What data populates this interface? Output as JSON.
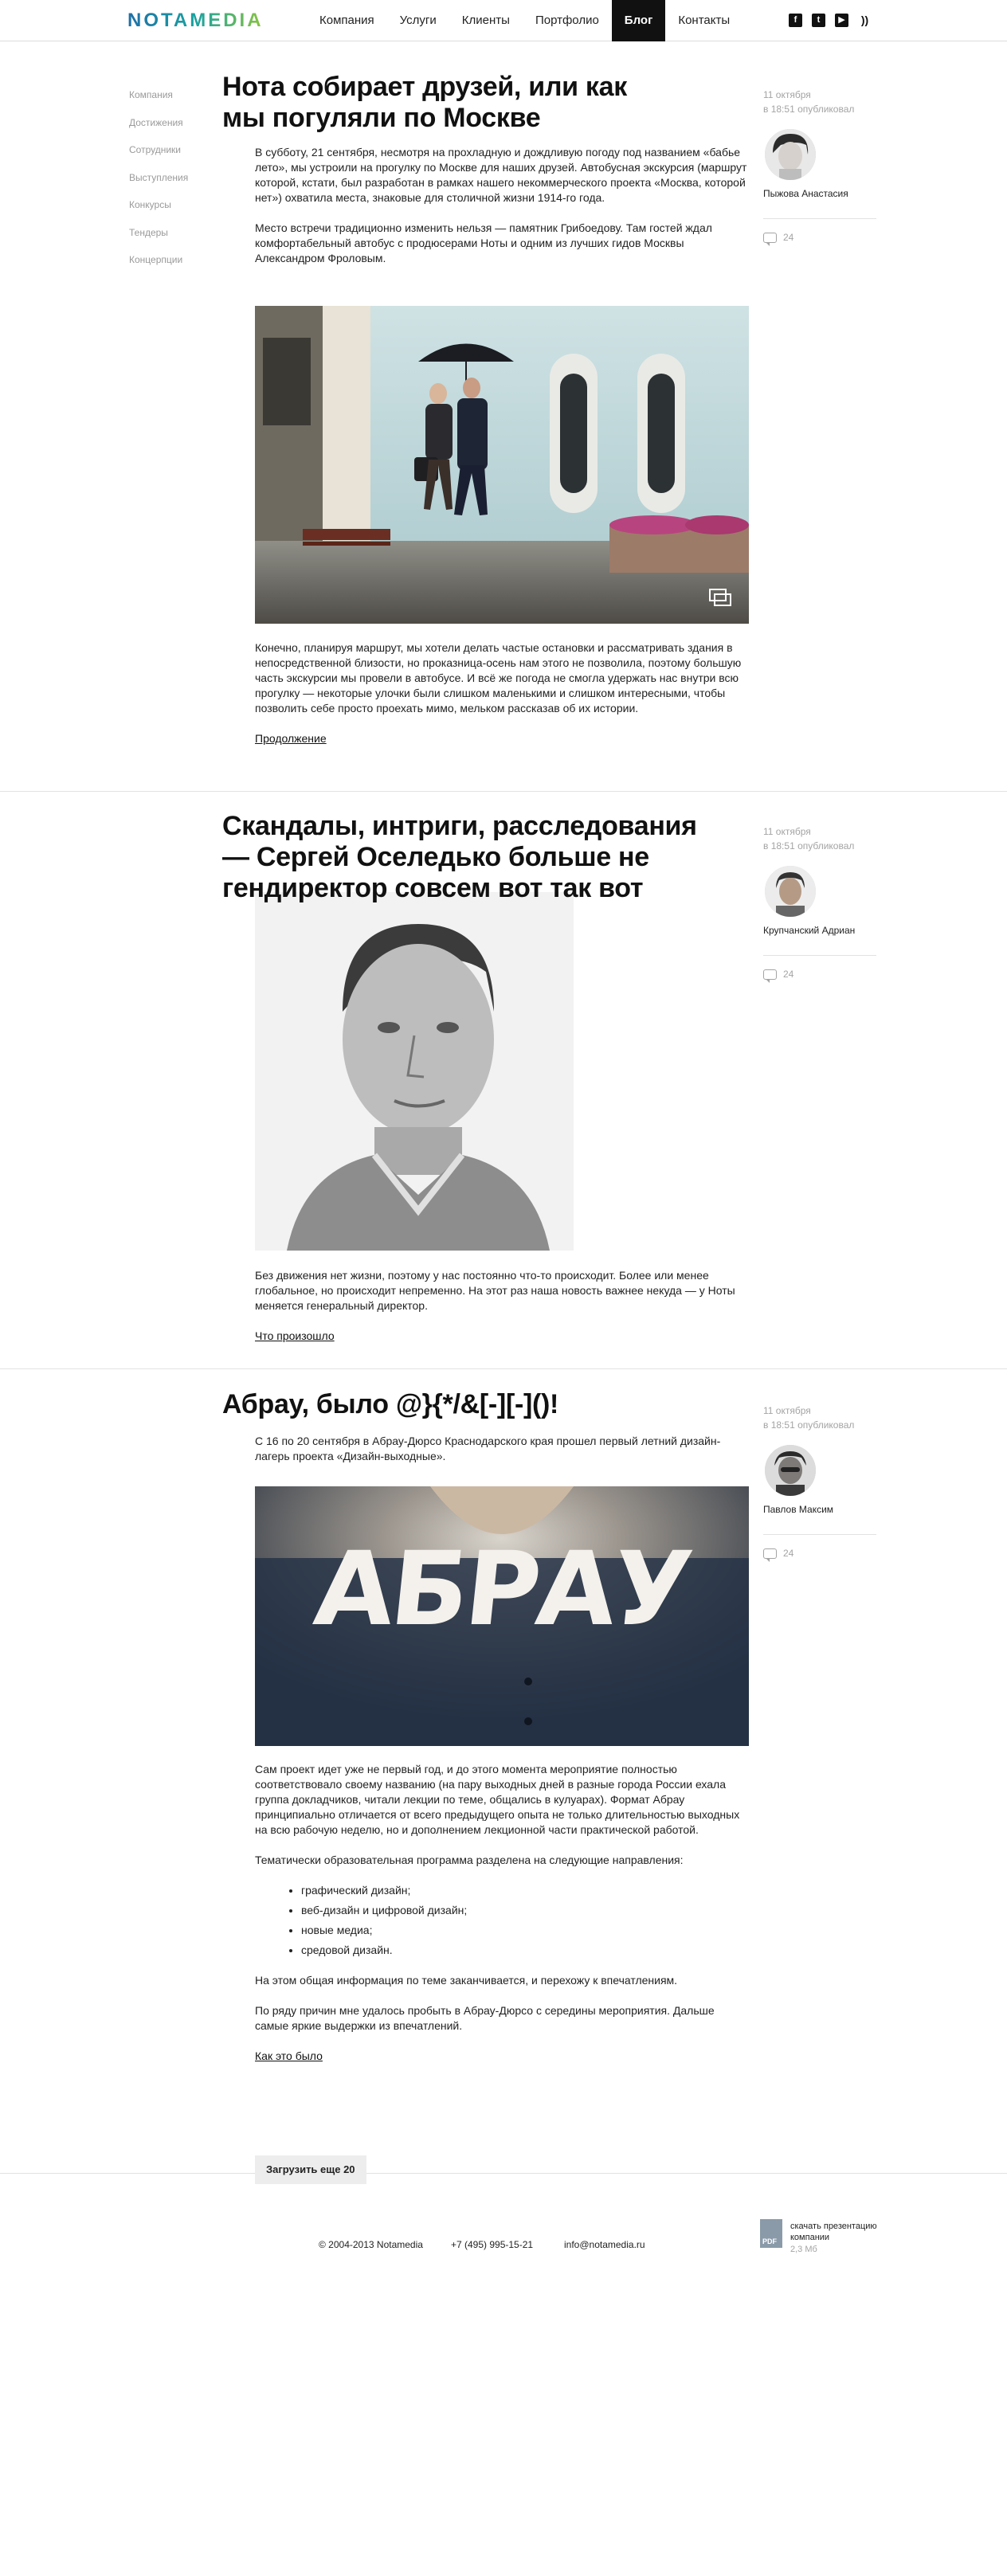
{
  "header": {
    "logo": "NOTAMEDIA",
    "nav": [
      "Компания",
      "Услуги",
      "Клиенты",
      "Портфолио",
      "Блог",
      "Контакты"
    ],
    "active_nav": "Блог",
    "social": [
      "f",
      "t",
      "▶",
      "rss"
    ]
  },
  "side_nav": [
    "Компания",
    "Достижения",
    "Сотрудники",
    "Выступления",
    "Конкурсы",
    "Тендеры",
    "Концерпции"
  ],
  "posts": [
    {
      "title": "Нота собирает друзей, или как мы погуляли по Москве",
      "date": "11 октября",
      "published": "в 18:51 опубликовал",
      "author": "Пыжова Анастасия",
      "comments": "24",
      "paragraphs": [
        "В субботу, 21 сентября, несмотря на прохладную и дождливую погоду под названием «бабье лето», мы устроили на прогулку по Москве для наших друзей. Автобусная экскурсия (маршрут которой, кстати, был разработан в рамках нашего некоммерческого проекта «Москва, которой нет») охватила места, знаковые для столичной жизни 1914-го года.",
        "Место встречи традиционно изменить нельзя — памятник Грибоедову. Там гостей ждал комфортабельный автобус с продюсерами Ноты и одним из лучших гидов Москвы Александром Фроловым."
      ],
      "paragraphs_after": [
        "Конечно, планируя маршрут, мы хотели делать частые остановки и рассматривать здания в непосредственной близости, но проказница-осень нам этого не позволила, поэтому большую часть экскурсии мы провели в автобусе. И всё же погода не смогла удержать нас внутри всю прогулку — некоторые улочки были слишком маленькими и слишком интересными, чтобы позволить себе просто проехать мимо, мельком рассказав об их истории."
      ],
      "link": "Продолжение"
    },
    {
      "title": "Скандалы, интриги, расследования — Сергей Оселедько больше не гендиректор совсем вот так вот",
      "date": "11 октября",
      "published": "в 18:51 опубликовал",
      "author": "Крупчанский Адриан",
      "comments": "24",
      "paragraphs_after": [
        "Без движения нет жизни, поэтому у нас постоянно что-то происходит. Более или менее глобальное, но происходит непременно. На этот раз наша новость важнее некуда — у Ноты меняется генеральный директор."
      ],
      "link": "Что произошло"
    },
    {
      "title": "Абрау, было @}{*/&[-][-]()!",
      "date": "11 октября",
      "published": "в 18:51 опубликовал",
      "author": "Павлов Максим",
      "comments": "24",
      "paragraphs": [
        "С 16 по 20 сентября в Абрау-Дюрсо Краснодарского края прошел первый летний дизайн-лагерь проекта «Дизайн-выходные»."
      ],
      "photo_text": "АБРАУ",
      "paragraphs_after": [
        "Сам проект идет уже не первый год, и до этого момента мероприятие полностью соответствовало своему названию (на пару выходных дней в разные города России ехала группа докладчиков, читали лекции по теме, общались в кулуарах). Формат Абрау принципиально отличается от всего предыдущего опыта не только длительностью выходных на всю рабочую неделю, но и дополнением лекционной части практической работой.",
        "Тематически образовательная программа разделена на следующие направления:"
      ],
      "list": [
        "графический дизайн;",
        "веб-дизайн и цифровой дизайн;",
        "новые медиа;",
        "средовой дизайн."
      ],
      "paragraphs_end": [
        "На этом общая информация по теме заканчивается, и перехожу к впечатлениям.",
        "По ряду причин мне удалось пробыть в Абрау-Дюрсо с середины мероприятия. Дальше самые яркие выдержки из впечатлений."
      ],
      "link": "Как это было"
    }
  ],
  "load_more": "Загрузить еще 20",
  "footer": {
    "copyright": "© 2004-2013 Notamedia",
    "phone": "+7 (495) 995-15-21",
    "email": "info@notamedia.ru",
    "pdf_label": "скачать презентацию компании",
    "pdf_size": "2,3 Мб",
    "pdf_icon_text": "PDF"
  }
}
